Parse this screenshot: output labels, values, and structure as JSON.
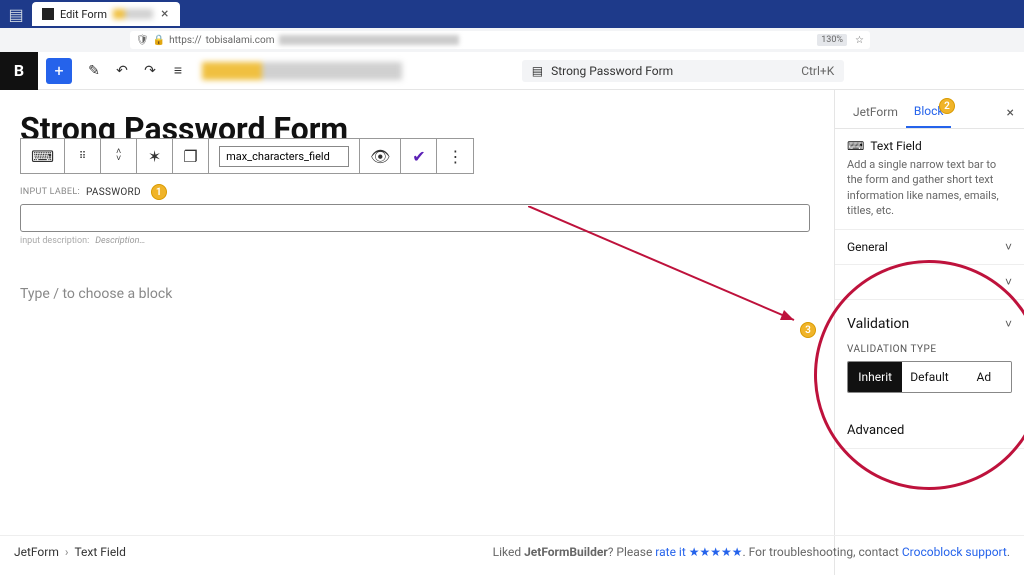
{
  "browser": {
    "tab_title": "Edit Form",
    "url_host": "tobisalami.com",
    "url_scheme": "https://",
    "zoom": "130%"
  },
  "toolbar": {
    "doc_title": "Strong Password Form",
    "shortcut": "Ctrl+K"
  },
  "canvas": {
    "form_heading": "Strong Password Form",
    "field_name": "max_characters_field",
    "input_label_key": "INPUT LABEL:",
    "input_label_value": "PASSWORD",
    "desc_key": "input description:",
    "desc_value": "Description…",
    "placeholder": "Type / to choose a block"
  },
  "sidebar": {
    "tabs": {
      "jetform": "JetForm",
      "block": "Block"
    },
    "block_name": "Text Field",
    "block_desc": "Add a single narrow text bar to the form and gather short text information like names, emails, titles, etc.",
    "sections": {
      "general": "General",
      "validation": "Validation",
      "validation_type_label": "VALIDATION TYPE",
      "val_inherit": "Inherit",
      "val_default": "Default",
      "val_advanced": "Ad",
      "advanced": "Advanced"
    }
  },
  "footer": {
    "crumb1": "JetForm",
    "crumb2": "Text Field",
    "promo_pre": "Liked ",
    "promo_bold": "JetFormBuilder",
    "promo_q": "? Please ",
    "promo_rate": "rate it ★★★★★",
    "promo_mid": ". For troubleshooting, contact ",
    "promo_link": "Crocoblock support"
  },
  "badges": {
    "one": "1",
    "two": "2",
    "three": "3"
  }
}
